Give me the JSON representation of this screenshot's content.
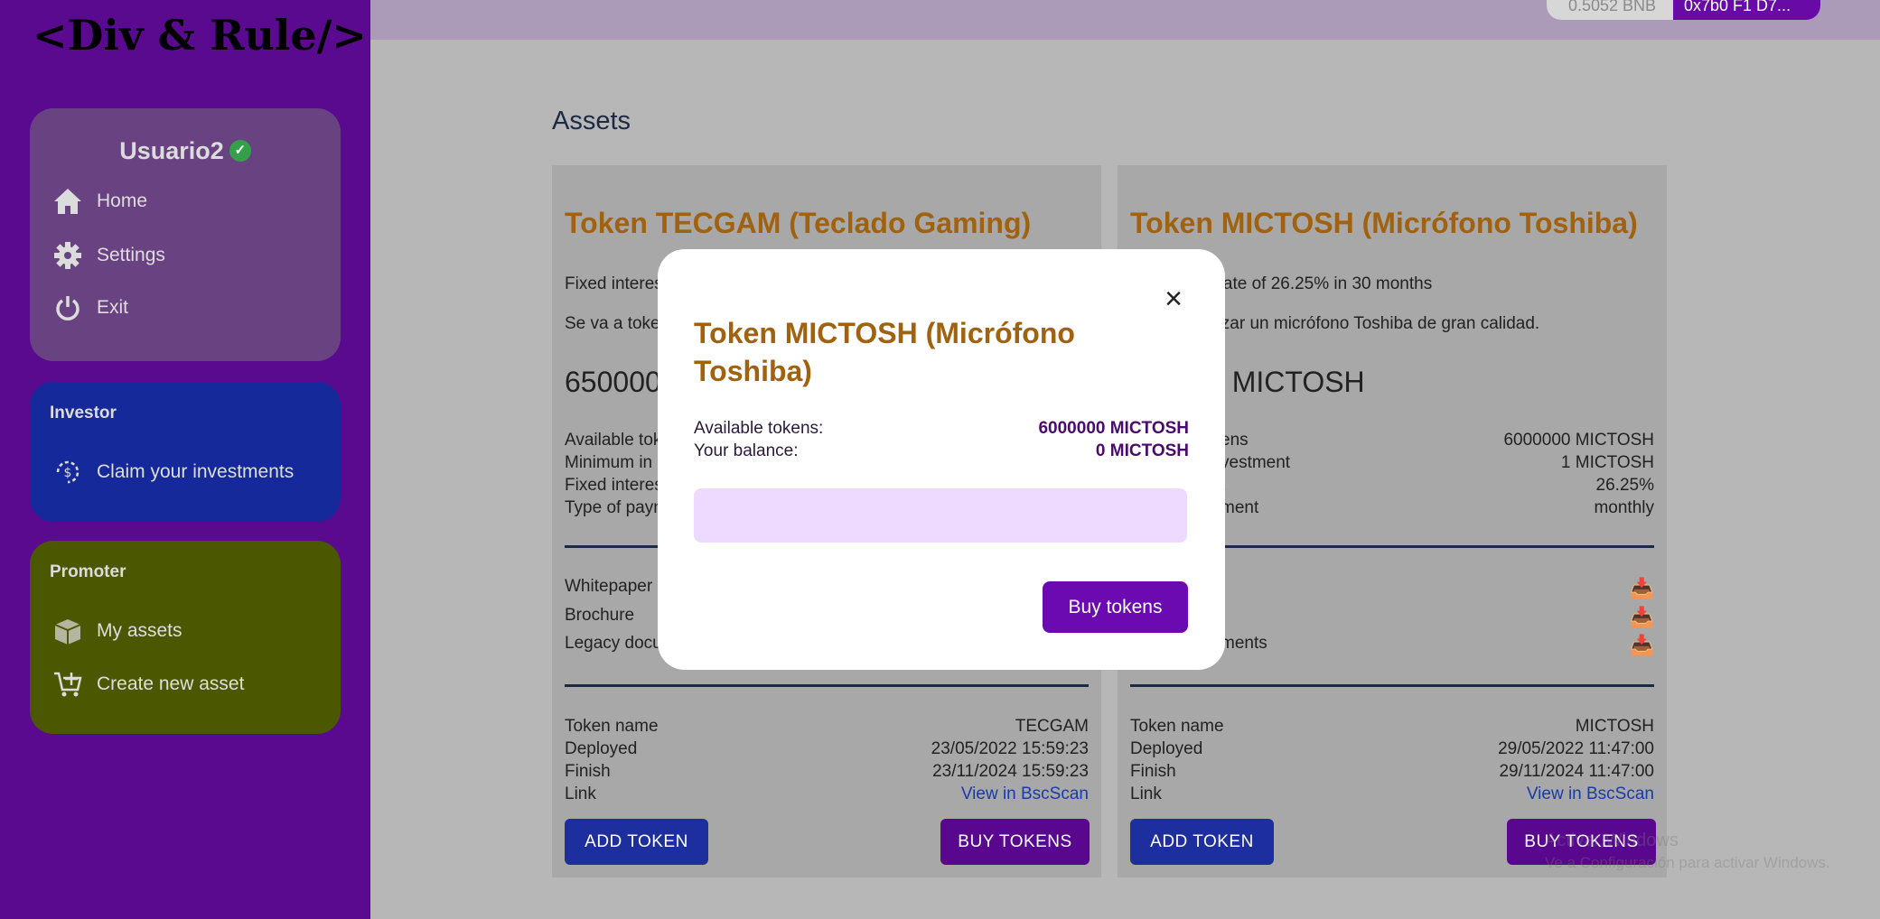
{
  "logo": "<Div & Rule/>",
  "sidebar": {
    "username": "Usuario2",
    "nav": [
      {
        "label": "Home",
        "icon": "home-icon"
      },
      {
        "label": "Settings",
        "icon": "gear-icon"
      },
      {
        "label": "Exit",
        "icon": "power-icon"
      }
    ],
    "investor": {
      "title": "Investor",
      "items": [
        {
          "label": "Claim your investments",
          "icon": "dollar-refresh-icon"
        }
      ]
    },
    "promoter": {
      "title": "Promoter",
      "items": [
        {
          "label": "My assets",
          "icon": "box-icon"
        },
        {
          "label": "Create new asset",
          "icon": "cart-plus-icon"
        }
      ]
    }
  },
  "topbar": {
    "balance": "0.5052 BNB",
    "address": "0x7b0 F1 D7..."
  },
  "page_title": "Assets",
  "cards": [
    {
      "title": "Token TECGAM (Teclado Gaming)",
      "desc1": "Fixed interes",
      "desc2": "Se va a toke",
      "amount": "650000",
      "rows": [
        {
          "k": "Available tok",
          "v": ""
        },
        {
          "k": "Minimum in",
          "v": ""
        },
        {
          "k": "Fixed interes",
          "v": ""
        },
        {
          "k": "Type of payn",
          "v": ""
        }
      ],
      "docs": [
        "Whitepaper",
        "Brochure",
        "Legacy docu"
      ],
      "info": [
        {
          "k": "Token name",
          "v": "TECGAM"
        },
        {
          "k": "Deployed",
          "v": "23/05/2022 15:59:23"
        },
        {
          "k": "Finish",
          "v": "23/11/2024 15:59:23"
        }
      ],
      "link_label": "Link",
      "link_text": "View in BscScan",
      "add_label": "ADD TOKEN",
      "buy_label": "BUY TOKENS"
    },
    {
      "title": "Token MICTOSH (Micrófono Toshiba)",
      "desc1": "t rate of 26.25% in 30 months",
      "desc2": "nizar un micrófono Toshiba de gran calidad.",
      "amount": "0 MICTOSH",
      "rows": [
        {
          "k": "ens",
          "v": "6000000 MICTOSH"
        },
        {
          "k": "vestment",
          "v": "1 MICTOSH"
        },
        {
          "k": "t",
          "v": "26.25%"
        },
        {
          "k": "ment",
          "v": "monthly"
        }
      ],
      "docs": [
        "",
        "",
        "ments"
      ],
      "info": [
        {
          "k": "Token name",
          "v": "MICTOSH"
        },
        {
          "k": "Deployed",
          "v": "29/05/2022 11:47:00"
        },
        {
          "k": "Finish",
          "v": "29/11/2024 11:47:00"
        }
      ],
      "link_label": "Link",
      "link_text": "View in BscScan",
      "add_label": "ADD TOKEN",
      "buy_label": "BUY TOKENS"
    }
  ],
  "modal": {
    "close": "×",
    "title": "Token MICTOSH (Micrófono Toshiba)",
    "available_label": "Available tokens:",
    "available_value": "6000000 MICTOSH",
    "balance_label": "Your balance:",
    "balance_value": "0 MICTOSH",
    "input_value": "",
    "buy_label": "Buy tokens"
  },
  "watermark": {
    "line1": "Activar Windows",
    "line2": "Ve a Configuración para activar Windows."
  }
}
